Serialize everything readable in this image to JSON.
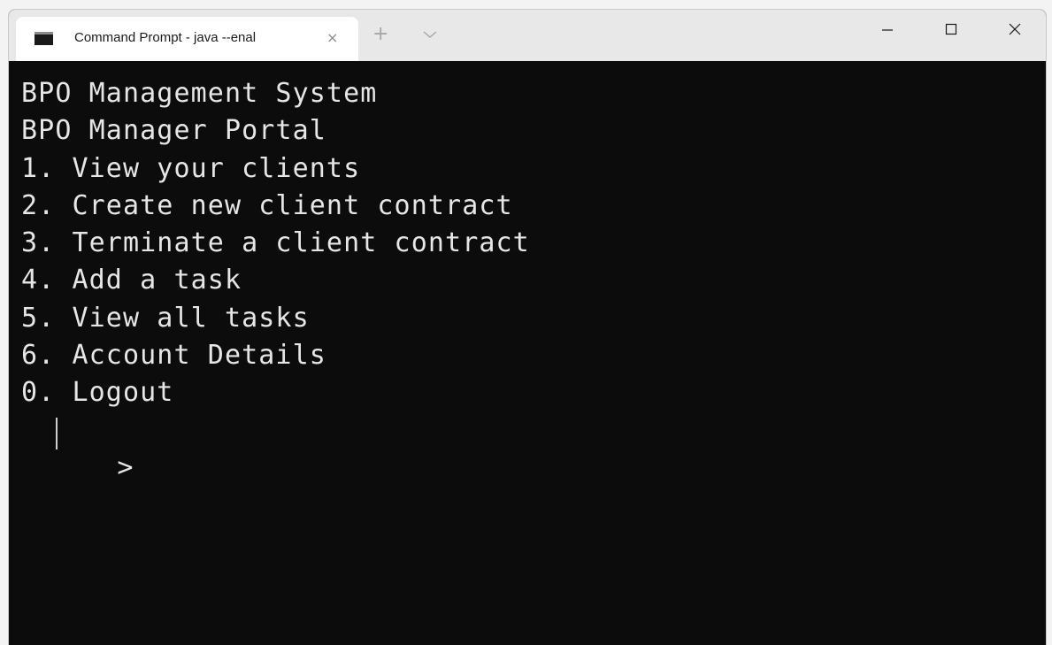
{
  "tab": {
    "title": "Command Prompt - java  --enal",
    "close_glyph": "×",
    "icon": "command-prompt-icon"
  },
  "titlebar": {
    "new_tab_glyph": "+",
    "dropdown_icon": "chevron-down-icon",
    "minimize_icon": "minimize-icon",
    "maximize_icon": "maximize-icon",
    "close_icon": "close-icon"
  },
  "terminal": {
    "lines": [
      "BPO Management System",
      "BPO Manager Portal",
      "1. View your clients",
      "2. Create new client contract",
      "3. Terminate a client contract",
      "4. Add a task",
      "5. View all tasks",
      "6. Account Details",
      "0. Logout"
    ],
    "prompt": ">"
  },
  "colors": {
    "terminal_background": "#0c0c0c",
    "terminal_text": "#e6e6e6",
    "titlebar_background": "#e8e8e8",
    "tab_background": "#ffffff"
  }
}
